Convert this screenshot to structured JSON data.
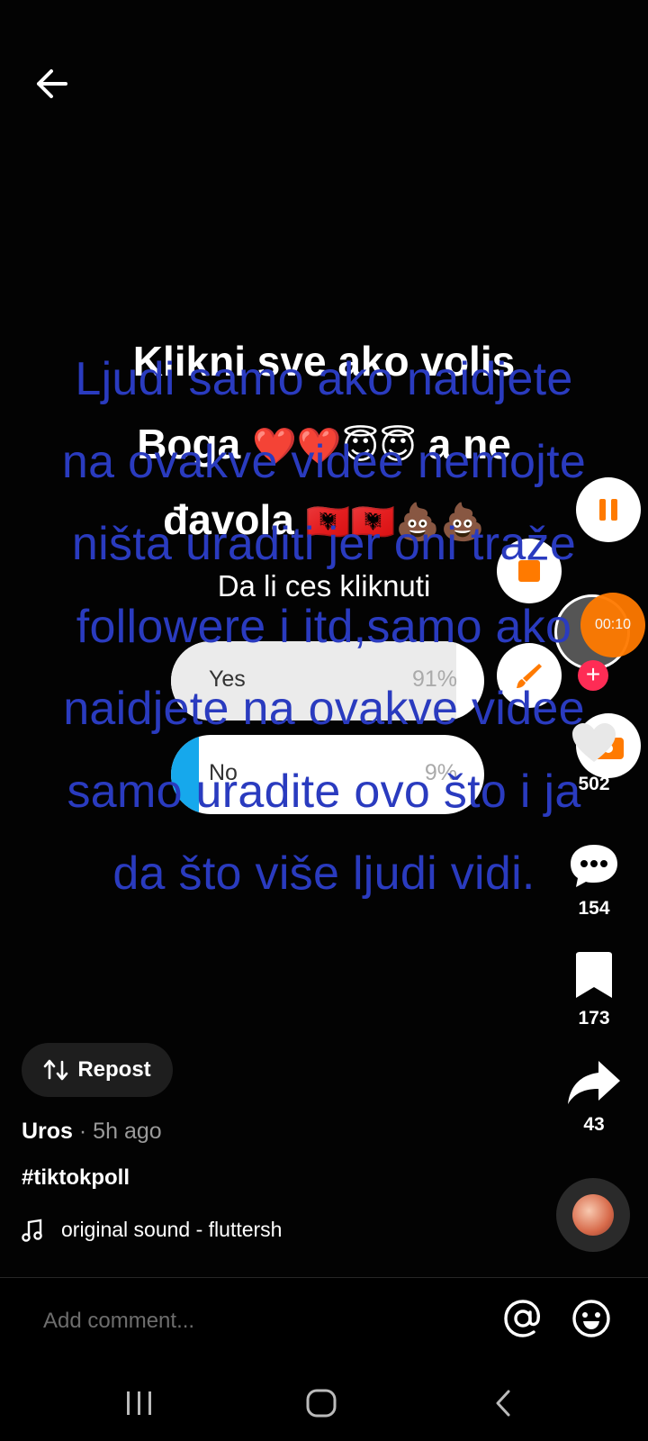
{
  "video": {
    "text_lines": [
      "Klikni sve ako volis",
      "Boga",
      "a ne",
      "đavola"
    ],
    "emojis": {
      "hearts": "❤️❤️",
      "angels": "😇😇",
      "flags": "🇦🇱🇦🇱",
      "poop": "💩💩"
    },
    "overlay_lines": [
      "Ljudi samo ako naidjete",
      "na ovakve videe nemojte",
      "ništa uraditi jer oni traže",
      "followere i itd,samo ako",
      "naidjete na ovakve videe",
      "samo uradite ovo što i ja",
      "da što više ljudi vidi."
    ]
  },
  "poll": {
    "question": "Da li ces kliknuti",
    "options": [
      {
        "label": "Yes",
        "percent_text": "91%",
        "fraction": 0.91
      },
      {
        "label": "No",
        "percent_text": "9%",
        "fraction": 0.09
      }
    ]
  },
  "sidebar": {
    "timer": "00:10",
    "likes": "502",
    "comments": "154",
    "saves": "173",
    "shares": "43"
  },
  "repost_label": "Repost",
  "author": {
    "name": "Uros",
    "meta": " · 5h ago"
  },
  "hashtag": "#tiktokpoll",
  "sound": "original sound - fluttersh",
  "comment_placeholder": "Add comment...",
  "colors": {
    "overlay_text": "#2a3bbf",
    "accent_orange": "#ff7a00",
    "poll_no_fill": "#16a8ec",
    "follow_red": "#fe2c55"
  }
}
